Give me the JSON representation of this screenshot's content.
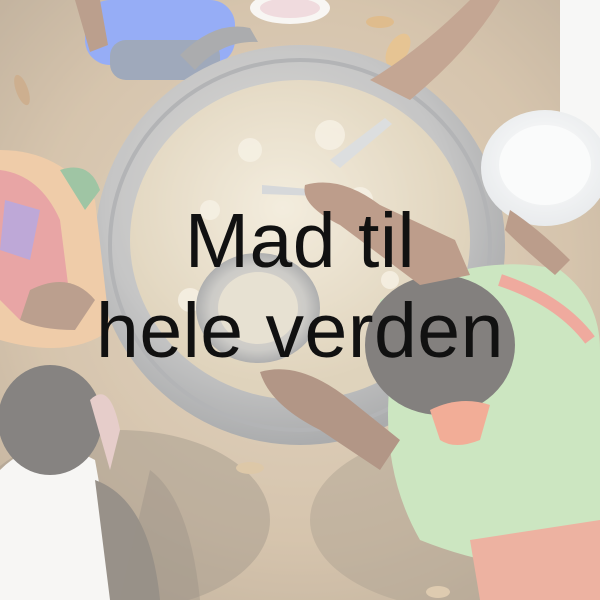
{
  "headline": {
    "line1": "Mad til",
    "line2": "hele verden"
  },
  "colors": {
    "text": "#111111",
    "overlay": "rgba(255,255,255,0.42)",
    "ground": "#c9b89c",
    "pot": "#9a9ca0",
    "rice": "#d8c9a6",
    "shirt_green": "#9fcf8c",
    "shirt_blue": "#3f6ff0"
  }
}
